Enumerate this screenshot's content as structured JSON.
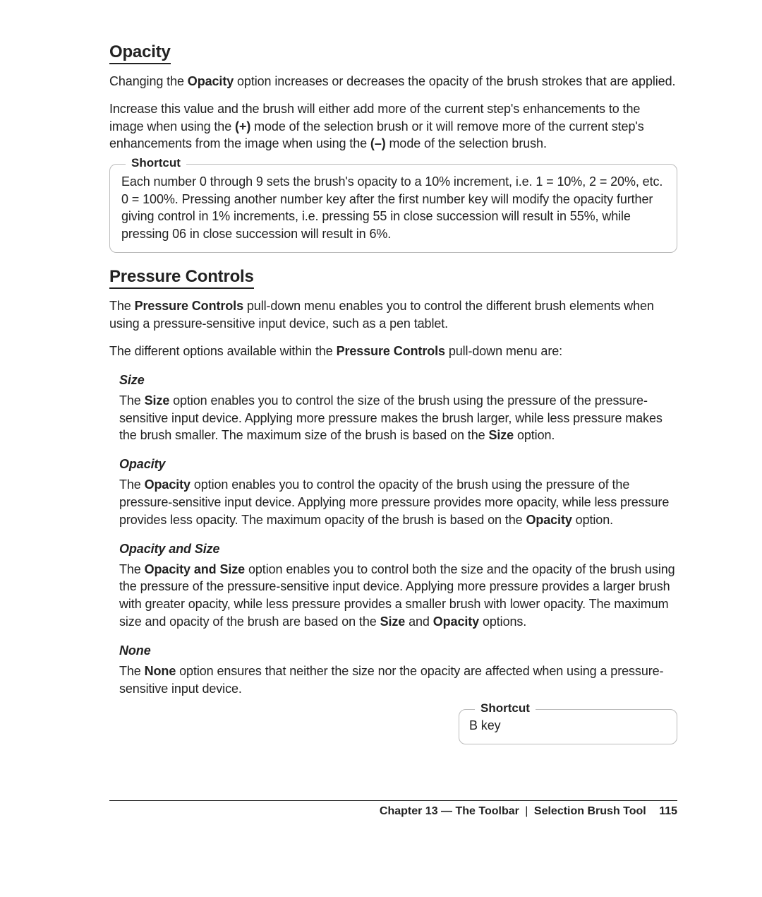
{
  "sections": {
    "opacity": {
      "heading": "Opacity",
      "p1_pre": "Changing the ",
      "p1_bold": "Opacity",
      "p1_post": " option increases or decreases the opacity of the brush strokes that are applied.",
      "p2_pre": "Increase this value and the brush will either add more of the current step's enhancements to the image when using the ",
      "p2_plus": "(+)",
      "p2_mid": " mode of the selection brush or it will remove more of the current step's enhancements from the image when using the ",
      "p2_minus": "(–)",
      "p2_post": " mode of the selection brush."
    },
    "shortcut1": {
      "label": "Shortcut",
      "text": "Each number 0 through 9 sets the brush's opacity to a 10% increment, i.e. 1 = 10%, 2 = 20%, etc. 0 = 100%. Pressing another number key after the first number key will modify the opacity further giving control in 1% increments, i.e. pressing 55 in close succession will result in 55%, while pressing 06 in close succession will result in 6%."
    },
    "pressure": {
      "heading": "Pressure Controls",
      "p1_pre": "The ",
      "p1_bold": "Pressure Controls",
      "p1_post": " pull-down menu enables you to control the different brush elements when using a pressure-sensitive input device, such as a pen tablet.",
      "p2_pre": "The different options available within the ",
      "p2_bold": "Pressure Controls",
      "p2_post": " pull-down menu are:"
    },
    "size": {
      "heading": "Size",
      "p_pre": "The ",
      "p_b1": "Size",
      "p_mid": " option enables you to control the size of the brush using the pressure of the pressure-sensitive input device. Applying more pressure makes the brush larger, while less pressure makes the brush smaller. The maximum size of the brush is based on the ",
      "p_b2": "Size",
      "p_post": " option."
    },
    "opacity2": {
      "heading": "Opacity",
      "p_pre": "The ",
      "p_b1": "Opacity",
      "p_mid": " option enables you to control the opacity of the brush using the pressure of the pressure-sensitive input device. Applying more pressure provides more opacity, while less pressure provides less opacity. The maximum opacity of the brush is based on the ",
      "p_b2": "Opacity",
      "p_post": " option."
    },
    "opsize": {
      "heading": "Opacity and Size",
      "p_pre": "The ",
      "p_b1": "Opacity and Size",
      "p_mid": " option enables you to control both the size and the opacity of the brush using the pressure of the pressure-sensitive input device. Applying more pressure provides a larger brush with greater opacity, while less pressure provides a smaller brush with lower opacity. The maximum size and opacity of the brush are based on the ",
      "p_b2": "Size",
      "p_and": " and ",
      "p_b3": "Opacity",
      "p_post": " options."
    },
    "none": {
      "heading": "None",
      "p_pre": "The ",
      "p_b1": "None",
      "p_post": " option ensures that neither the size nor the opacity are affected when using a pressure-sensitive input device."
    },
    "shortcut2": {
      "label": "Shortcut",
      "text": "B key"
    }
  },
  "footer": {
    "chapter": "Chapter 13 — The Toolbar",
    "divider": "|",
    "tool": "Selection Brush Tool",
    "page": "115"
  }
}
